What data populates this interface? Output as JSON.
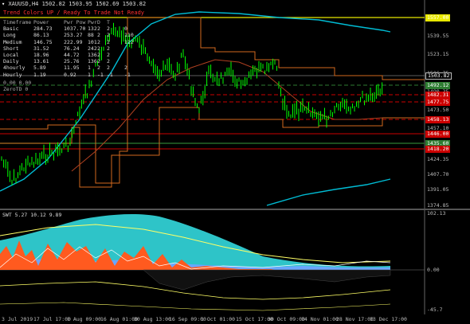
{
  "header": {
    "symbol_title": "XAUUSD,H4  1502.82 1503.95 1502.69 1503.82",
    "status": "Trend Colors  UP  /  Ready To Trade  Not Ready",
    "sub_title": "SWT 5.27 10.12 9.89"
  },
  "panel": {
    "headers": [
      "Timeframe",
      "Power",
      "Pwr Pow",
      "Pwr",
      "D",
      "T",
      ""
    ],
    "rows": [
      {
        "name": "Basic",
        "v1": "284.73",
        "v2": "1037.70",
        "v3": "132",
        "v4": "2",
        "v5": "2",
        "v6": "0"
      },
      {
        "name": "Long",
        "v1": "86.13",
        "v2": "253.27",
        "v3": "88",
        "v4": "2",
        "v5": "2",
        "v6": "110"
      },
      {
        "name": "Medium",
        "v1": "146.75",
        "v2": "222.99",
        "v3": "101",
        "v4": "2",
        "v5": "2",
        "v6": "112"
      },
      {
        "name": "Short",
        "v1": "31.52",
        "v2": "76.24",
        "v3": "242",
        "v4": "2",
        "v5": "2",
        "v6": ""
      },
      {
        "name": "Local",
        "v1": "18.96",
        "v2": "44.72",
        "v3": "136",
        "v4": "2",
        "v5": "2",
        "v6": ""
      },
      {
        "name": "Daily",
        "v1": "13.61",
        "v2": "25.76",
        "v3": "136",
        "v4": "2",
        "v5": "2",
        "v6": ""
      },
      {
        "name": "4hourly",
        "v1": "5.89",
        "v2": "11.95",
        "v3": "1",
        "v4": "2",
        "v5": "2",
        "v6": "2"
      },
      {
        "name": "Hourly",
        "v1": "1.19",
        "v2": "0.92",
        "v3": "1",
        "v4": "-1",
        "v5": "-1",
        "v6": "-1"
      }
    ],
    "line_lower1": "ZeroTD  0",
    "line_lower2": "0.00 0.00"
  },
  "price_axis": {
    "labels": [
      "1557.00",
      "1539.55",
      "1523.15",
      "1506.75",
      "1490.35",
      "1473.50",
      "1457.10",
      "1440.70",
      "1424.35",
      "1407.70",
      "1391.05",
      "1374.85"
    ],
    "tags": [
      {
        "text": "1557.00",
        "color": "#e8e800"
      },
      {
        "text": "1503.82",
        "color": "#000000"
      },
      {
        "text": "1492.12",
        "color": "#2e7d32"
      },
      {
        "text": "1482.31",
        "color": "#cc0000"
      },
      {
        "text": "1477.75",
        "color": "#cc0000"
      },
      {
        "text": "1458.13",
        "color": "#cc0000"
      },
      {
        "text": "1446.00",
        "color": "#cc0000"
      },
      {
        "text": "1435.60",
        "color": "#2e7d32"
      },
      {
        "text": "1418.20",
        "color": "#cc0000"
      }
    ]
  },
  "sub_axis": {
    "labels": [
      "102.13",
      "0.00",
      "-45.7"
    ]
  },
  "time_axis": {
    "labels": [
      "3 Jul 2019",
      "17 Jul 17:00",
      "1 Aug 09:00",
      "16 Aug 01:00",
      "30 Aug 13:00",
      "16 Sep 09:00",
      "1 Oct 01:00",
      "15 Oct 17:00",
      "30 Oct 09:00",
      "14 Nov 01:00",
      "28 Nov 17:00",
      "13 Dec 17:00"
    ]
  },
  "colors": {
    "background": "#000000",
    "candle": "#00ff00",
    "ma_cyan": "#00bcd4",
    "level_yellow": "#e8e800",
    "level_red": "#cc0000",
    "channel_brown": "#d2691e",
    "sub_fill_cyan": "#2ec4c8",
    "sub_fill_orange": "#ff5a1f",
    "sub_fill_blue": "#6aa6ff",
    "sub_line_yellow": "#ffff66"
  }
}
